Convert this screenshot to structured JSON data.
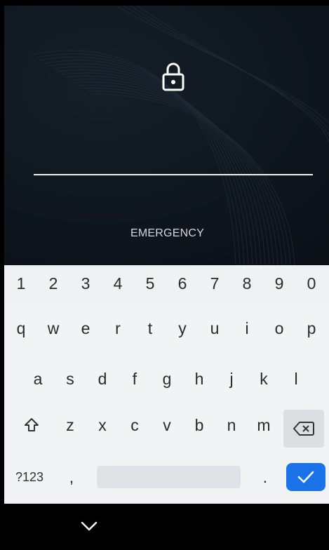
{
  "lockscreen": {
    "emergency_label": "EMERGENCY"
  },
  "keyboard": {
    "numbers": [
      "1",
      "2",
      "3",
      "4",
      "5",
      "6",
      "7",
      "8",
      "9",
      "0"
    ],
    "row1": [
      "q",
      "w",
      "e",
      "r",
      "t",
      "y",
      "u",
      "i",
      "o",
      "p"
    ],
    "row2": [
      "a",
      "s",
      "d",
      "f",
      "g",
      "h",
      "j",
      "k",
      "l"
    ],
    "row3": [
      "z",
      "x",
      "c",
      "v",
      "b",
      "n",
      "m"
    ],
    "symbols_label": "?123",
    "comma_label": ",",
    "period_label": ".",
    "icons": {
      "shift": "shift-icon",
      "backspace": "backspace-icon",
      "enter": "checkmark-icon"
    },
    "enter_color": "#1a73e8"
  },
  "navigation": {
    "icons": [
      "chevron-down-icon"
    ]
  }
}
